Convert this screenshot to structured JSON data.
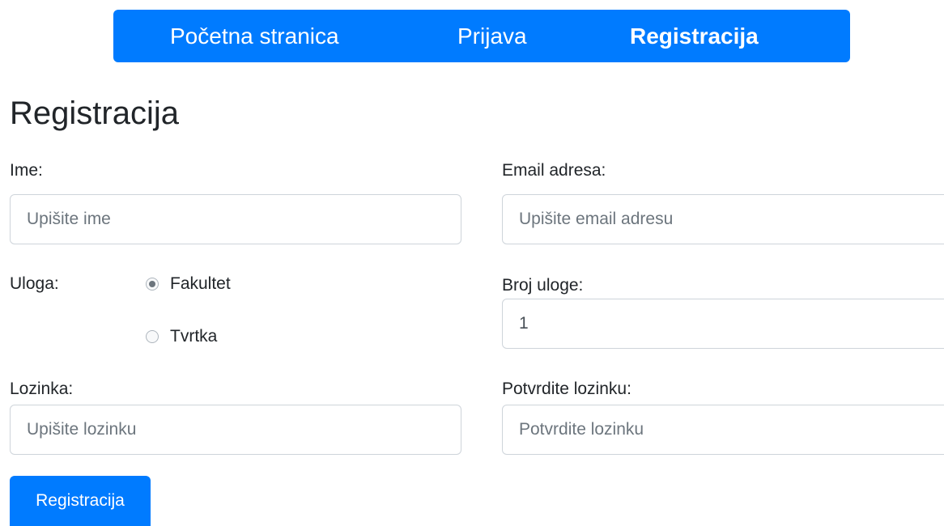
{
  "nav": {
    "home": "Početna stranica",
    "login": "Prijava",
    "register": "Registracija"
  },
  "page_title": "Registracija",
  "form": {
    "name_label": "Ime:",
    "name_placeholder": "Upišite ime",
    "email_label": "Email adresa:",
    "email_placeholder": "Upišite email adresu",
    "role_label": "Uloga:",
    "role_options": [
      {
        "label": "Fakultet",
        "checked": true
      },
      {
        "label": "Tvrtka",
        "checked": false
      }
    ],
    "role_number_label": "Broj uloge:",
    "role_number_value": "1",
    "password_label": "Lozinka:",
    "password_placeholder": "Upišite lozinku",
    "confirm_label": "Potvrdite lozinku:",
    "confirm_placeholder": "Potvrdite lozinku",
    "submit_label": "Registracija"
  },
  "colors": {
    "accent": "#007bff",
    "text": "#212529",
    "placeholder": "#6c757d",
    "border": "#ced4da"
  }
}
